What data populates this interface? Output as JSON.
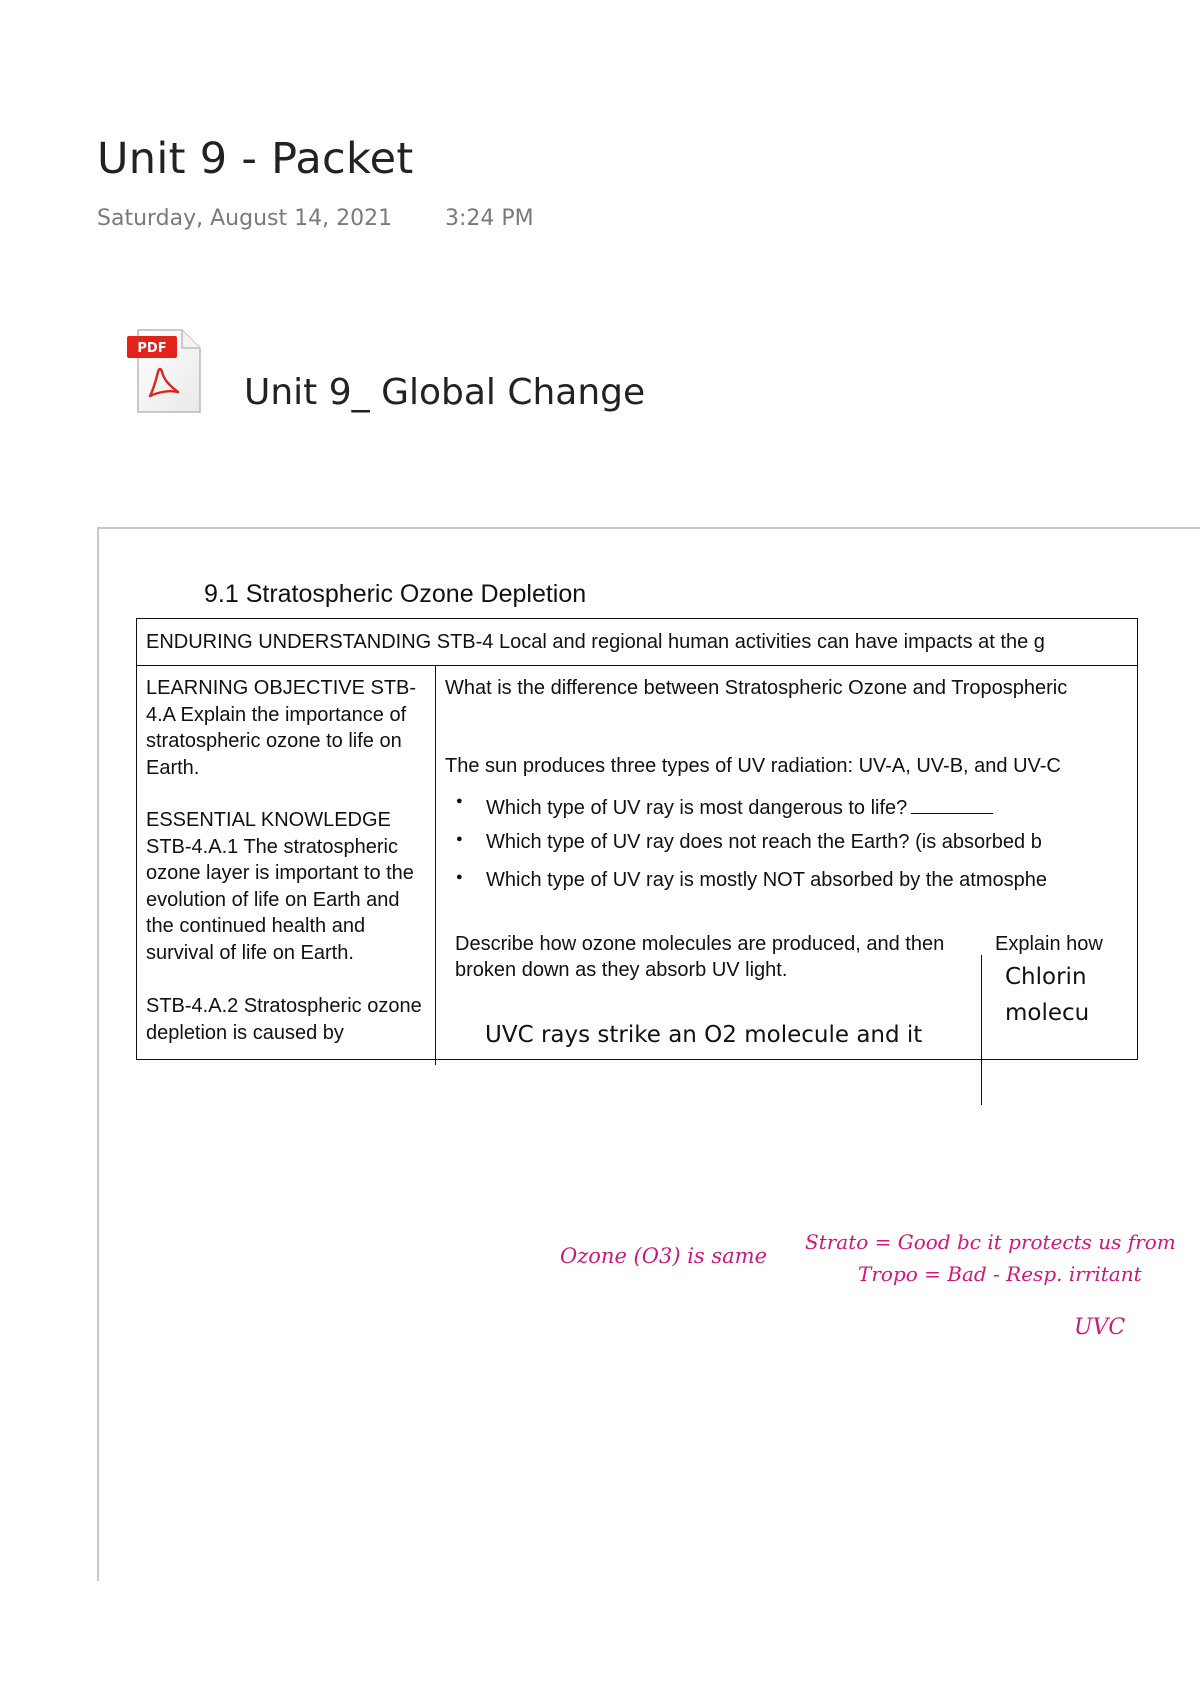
{
  "page": {
    "title": "Unit 9 - Packet",
    "date": "Saturday, August 14, 2021",
    "time": "3:24 PM"
  },
  "attachment": {
    "badge": "PDF",
    "name": "Unit 9_ Global Change",
    "icon": "pdf-file-icon"
  },
  "worksheet": {
    "heading": "9.1 Stratospheric Ozone Depletion",
    "enduring": "ENDURING UNDERSTANDING STB-4 Local and regional human activities can have impacts at the g",
    "left_column": [
      "LEARNING OBJECTIVE STB-4.A Explain the importance of stratospheric ozone to life on Earth.",
      "ESSENTIAL KNOWLEDGE STB-4.A.1 The stratospheric ozone layer is important to the evolution of life on Earth and the continued health and survival of life on Earth.",
      "STB-4.A.2 Stratospheric ozone depletion is caused by"
    ],
    "question": "What is the difference between Stratospheric Ozone and Tropospheric",
    "uv_intro": "The sun produces three types of UV radiation: UV-A, UV-B, and UV-C",
    "bullets": [
      "Which type of UV ray is most dangerous to life?",
      "Which type of UV ray does not reach the Earth? (is absorbed b",
      "Which type of UV ray is mostly NOT absorbed by the atmosphe"
    ],
    "describe_prompt": "Describe how ozone molecules are produced, and then broken down as they absorb UV light.",
    "explain_prompt": "Explain how",
    "typed_answer_left": "UVC rays strike an O2 molecule and it",
    "typed_answer_right": [
      "Chlorin",
      "molecu"
    ]
  },
  "annotations": {
    "ozone_same": "Ozone (O3) is same",
    "strato": "Strato = Good bc it protects us from",
    "tropo": "Tropo = Bad - Resp. irritant",
    "uvc_answer": "UVC"
  },
  "colors": {
    "ink": "#d0177a",
    "meta_text": "#7a7a7a",
    "pdf_red": "#e2231a"
  }
}
